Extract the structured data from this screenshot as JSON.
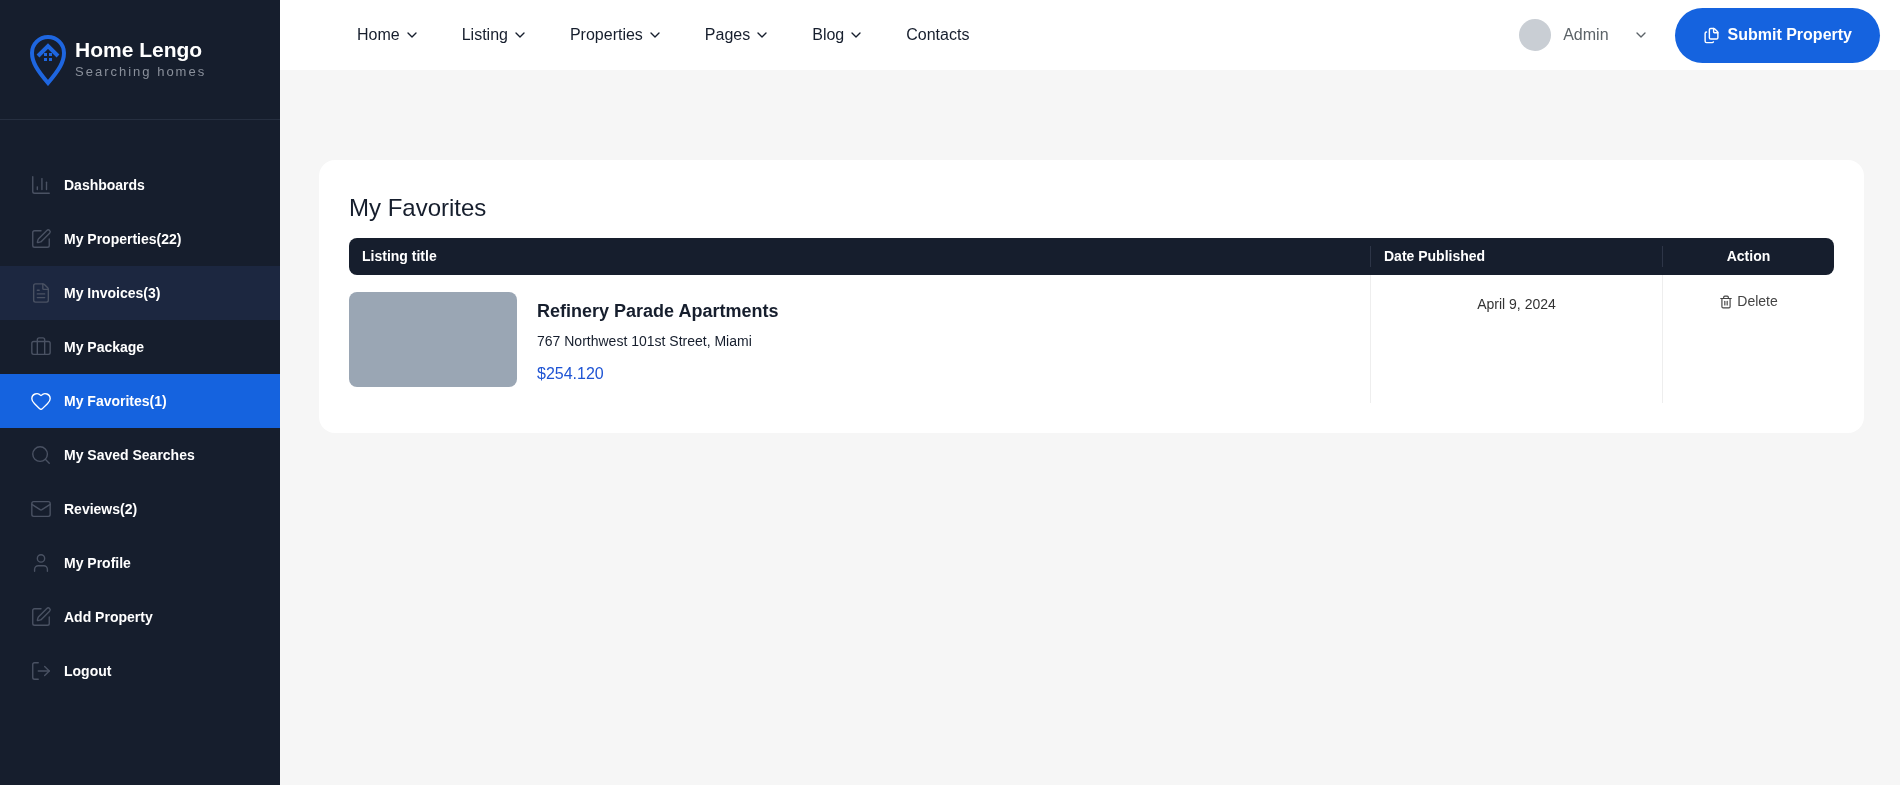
{
  "brand": {
    "name": "Home Lengo",
    "tagline": "Searching homes"
  },
  "sidebar": {
    "items": [
      {
        "kind": "dashboard",
        "label": "Dashboards",
        "selected": false
      },
      {
        "kind": "edit",
        "label": "My Properties(22)",
        "selected": false
      },
      {
        "kind": "invoice",
        "label": "My Invoices(3)",
        "selected": false,
        "highlighted": true
      },
      {
        "kind": "package",
        "label": "My Package",
        "selected": false
      },
      {
        "kind": "heart",
        "label": "My Favorites(1)",
        "selected": true
      },
      {
        "kind": "search",
        "label": "My Saved Searches",
        "selected": false
      },
      {
        "kind": "mail",
        "label": "Reviews(2)",
        "selected": false
      },
      {
        "kind": "user",
        "label": "My Profile",
        "selected": false
      },
      {
        "kind": "edit",
        "label": "Add Property",
        "selected": false
      },
      {
        "kind": "logout",
        "label": "Logout",
        "selected": false
      }
    ]
  },
  "nav": {
    "items": [
      {
        "label": "Home",
        "dropdown": true
      },
      {
        "label": "Listing",
        "dropdown": true
      },
      {
        "label": "Properties",
        "dropdown": true
      },
      {
        "label": "Pages",
        "dropdown": true
      },
      {
        "label": "Blog",
        "dropdown": true
      },
      {
        "label": "Contacts",
        "dropdown": false
      }
    ],
    "user": "Admin",
    "submit_button": "Submit Property"
  },
  "favorites": {
    "title": "My Favorites",
    "columns": [
      "Listing title",
      "Date Published",
      "Action"
    ],
    "rows": [
      {
        "title": "Refinery Parade Apartments",
        "address": "767 Northwest 101st Street, Miami",
        "price": "$254.120",
        "date": "April 9, 2024",
        "action": "Delete"
      }
    ]
  }
}
